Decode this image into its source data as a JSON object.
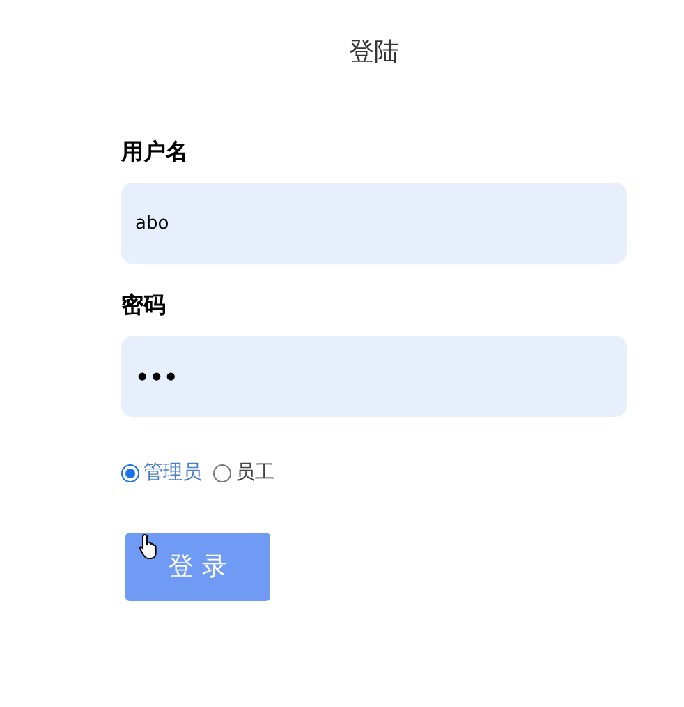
{
  "title": "登陆",
  "fields": [
    {
      "label": "用户名",
      "value": "abo",
      "kind": "text"
    },
    {
      "label": "密码",
      "value": "•••",
      "kind": "password"
    }
  ],
  "roles": [
    {
      "label": "管理员",
      "selected": true
    },
    {
      "label": "员工",
      "selected": false
    }
  ],
  "submit": "登 录"
}
